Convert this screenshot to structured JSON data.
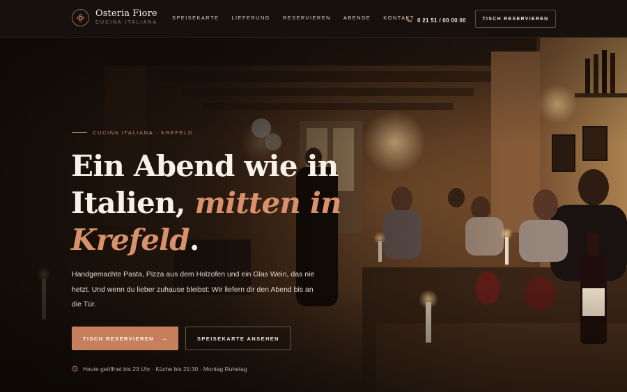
{
  "header": {
    "brand_name": "Osteria Fiore",
    "brand_sub": "CUCINA ITALIANA",
    "nav": [
      {
        "label": "SPEISEKARTE"
      },
      {
        "label": "LIEFERUNG"
      },
      {
        "label": "RESERVIEREN"
      },
      {
        "label": "ABENDE"
      },
      {
        "label": "KONTAKT"
      }
    ],
    "phone": "0 21 51 / 00 00 00",
    "cta_label": "TISCH RESERVIEREN"
  },
  "hero": {
    "eyebrow": "CUCINA ITALIANA · KREFELD",
    "headline_line1": "Ein Abend wie in",
    "headline_line2_plain": "Italien,",
    "headline_line2_accent": "mitten in",
    "headline_line3_accent": "Krefeld",
    "headline_line3_tail": ".",
    "lead": "Handgemachte Pasta, Pizza aus dem Holzofen und ein Glas Wein, das nie hetzt. Und wenn du lieber zuhause bleibst: Wir liefern dir den Abend bis an die Tür.",
    "primary_button": "TISCH RESERVIEREN",
    "primary_arrow": "→",
    "secondary_button": "SPEISEKARTE ANSEHEN",
    "hours": "Heute geöffnet bis 23 Uhr · Küche bis 21:30 · Montag Ruhetag"
  },
  "colors": {
    "accent": "#c7805d",
    "accent_text": "#d9906c",
    "header_bg": "#17110d"
  },
  "icons": {
    "logo": "flower-logo-icon",
    "phone": "phone-icon",
    "hours": "clock-icon",
    "arrow": "arrow-right-icon"
  }
}
